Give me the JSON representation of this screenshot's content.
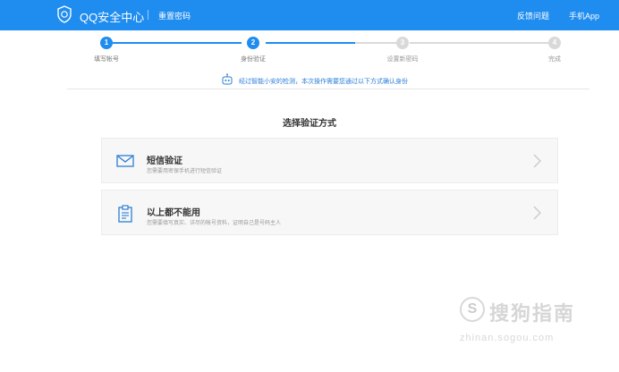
{
  "header": {
    "brand": "QQ安全中心",
    "subtitle": "重置密码",
    "nav": {
      "feedback": "反馈问题",
      "app": "手机App"
    }
  },
  "steps": [
    {
      "number": "1",
      "label": "填写帐号",
      "state": "done"
    },
    {
      "number": "2",
      "label": "身份验证",
      "state": "current"
    },
    {
      "number": "3",
      "label": "设置新密码",
      "state": "todo"
    },
    {
      "number": "4",
      "label": "完成",
      "state": "todo"
    }
  ],
  "notice": "经过智能小安的检测，本次操作需要您通过以下方式确认身份",
  "section_title": "选择验证方式",
  "options": [
    {
      "title": "短信验证",
      "desc": "您需要用密保手机进行短信验证",
      "icon": "envelope-icon"
    },
    {
      "title": "以上都不能用",
      "desc": "您需要填写真实、详尽的帐号资料，证明自己是号码主人",
      "icon": "clipboard-icon"
    }
  ],
  "watermark": {
    "text": "搜狗指南",
    "url": "zhinan.sogou.com"
  },
  "colors": {
    "primary": "#1f8cf0",
    "inactive": "#d9d9d9",
    "notice": "#2b7fd6"
  }
}
